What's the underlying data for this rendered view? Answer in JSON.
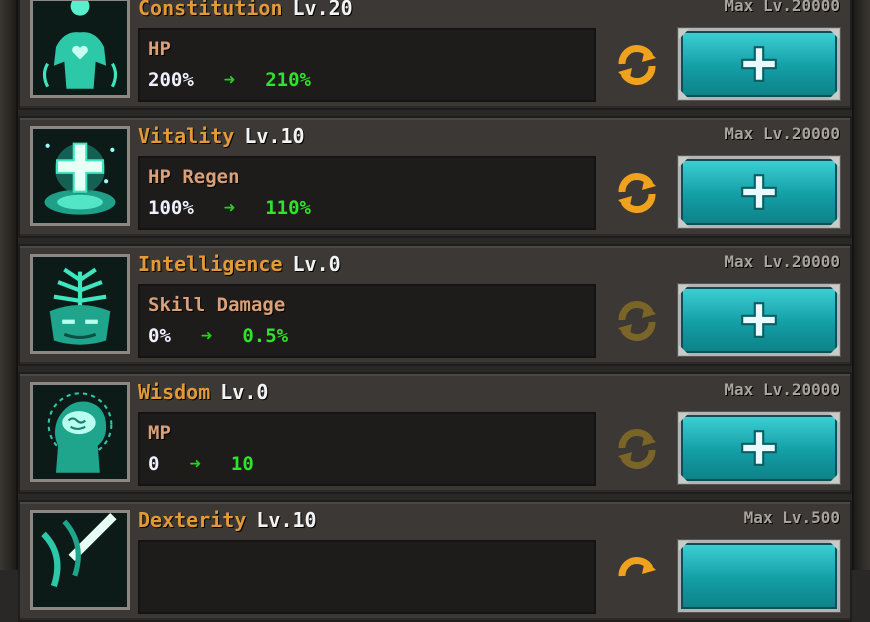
{
  "stats": [
    {
      "name": "Constitution",
      "level": "Lv.20",
      "max": "Max Lv.20000",
      "effect": "HP",
      "current": "200%",
      "next": "210%",
      "icon": "body-heart-icon",
      "reset_active": true
    },
    {
      "name": "Vitality",
      "level": "Lv.10",
      "max": "Max Lv.20000",
      "effect": "HP Regen",
      "current": "100%",
      "next": "110%",
      "icon": "holy-cross-icon",
      "reset_active": true
    },
    {
      "name": "Intelligence",
      "level": "Lv.0",
      "max": "Max Lv.20000",
      "effect": "Skill Damage",
      "current": "0%",
      "next": "0.5%",
      "icon": "tree-mind-icon",
      "reset_active": false
    },
    {
      "name": "Wisdom",
      "level": "Lv.0",
      "max": "Max Lv.20000",
      "effect": "MP",
      "current": "0",
      "next": "10",
      "icon": "brain-head-icon",
      "reset_active": false
    },
    {
      "name": "Dexterity",
      "level": "Lv.10",
      "max": "Max Lv.500",
      "effect": "",
      "current": "",
      "next": "",
      "icon": "sword-icon",
      "reset_active": true
    }
  ],
  "arrow_glyph": "➜",
  "colors": {
    "accent": "#e39a36",
    "positive": "#2fe22a",
    "upgrade": "#139ea6",
    "reset_active": "#f0a21e",
    "reset_inactive": "#7a6427"
  }
}
